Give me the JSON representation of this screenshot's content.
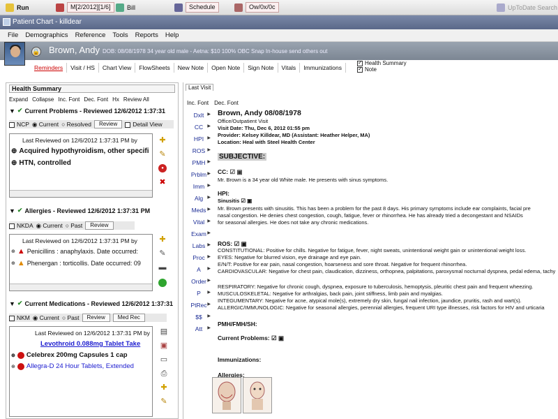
{
  "taskbar": {
    "run_label": "Run",
    "date_box": "M[2/2012][1/6]",
    "bill_label": "Bill",
    "schedule_label": "Schedule",
    "dx_box": "Ow/0x/0c",
    "right_label": "UpToDate Search"
  },
  "window_title": "Patient Chart - killdear",
  "menu": [
    "File",
    "Demographics",
    "Reference",
    "Tools",
    "Reports",
    "Help"
  ],
  "patient": {
    "name": "Brown, Andy",
    "info": "DOB: 08/08/1978  34 year old male - Aetna: $10 100% OBC  Snap In-house  send others out"
  },
  "nav_tabs": [
    "Reminders",
    "Visit / HS",
    "Chart View",
    "FlowSheets",
    "New Note",
    "Open Note",
    "Sign Note",
    "Vitals",
    "Immunizations"
  ],
  "checks": {
    "health_summary": "Health Summary",
    "note": "Note"
  },
  "left": {
    "title": "Health Summary",
    "toolbar": [
      "Expand",
      "Collapse",
      "Inc. Font",
      "Dec. Font",
      "Hx",
      "Review All"
    ],
    "problems": {
      "header": "Current Problems  - Reviewed 12/6/2012 1:37:31",
      "opts": [
        "NCP",
        "Current",
        "Resolved",
        "Review",
        "Detail View"
      ],
      "last_reviewed": "Last Reviewed on 12/6/2012 1:37:31 PM by",
      "items": [
        "Acquired hypothyroidism, other specifi",
        "HTN, controlled"
      ]
    },
    "allergies": {
      "header": "Allergies  - Reviewed 12/6/2012 1:37:31 PM",
      "opts": [
        "NKDA",
        "Current",
        "Past",
        "Review"
      ],
      "last_reviewed": "Last Reviewed on 12/6/2012 1:37:31 PM by",
      "items": [
        "Penicillins : anaphylaxis. Date occurred:",
        "Phenergan : torticollis. Date occurred: 09"
      ]
    },
    "meds": {
      "header": "Current Medications  - Reviewed 12/6/2012 1:37:31",
      "opts": [
        "NKM",
        "Current",
        "Past",
        "Review",
        "Med Rec"
      ],
      "last_reviewed": "Last Reviewed on 12/6/2012 1:37:31 PM by",
      "items": [
        "Levothroid 0.088mg Tablet Take",
        "Celebrex 200mg Capsules 1 cap",
        "Allegra-D 24 Hour Tablets, Extended"
      ]
    }
  },
  "right": {
    "tab": "Last Visit",
    "font_tools": [
      "Inc. Font",
      "Dec. Font"
    ],
    "side_nav": [
      "Dxlt",
      "CC",
      "HPI",
      "ROS",
      "PMH",
      "Prblm",
      "Imm",
      "Alg",
      "Meds",
      "Vital",
      "Exam",
      "Labs",
      "Proc",
      "A",
      "Order",
      "P",
      "PtRec",
      "$$",
      "Att"
    ],
    "note": {
      "header_name": "Brown, Andy  08/08/1978",
      "office": "Office/Outpatient Visit",
      "visit_date": "Visit Date: Thu, Dec 6, 2012 01:55 pm",
      "provider": "Provider: Kelsey Killdear, MD (Assistant: Heather Helper, MA)",
      "location": "Location: Heal with Steel Health Center",
      "subjective": "SUBJECTIVE:",
      "cc_label": "CC:",
      "cc_text": "Mr. Brown is a 34 year old White male.   He presents with sinus symptoms.",
      "hpi_label": "HPI:",
      "sinusitis_label": "Sinusitis",
      "hpi_1": "Mr. Brown presents with sinusitis.   This has been a problem for the past 8 days.   His primary symptoms include ear complaints, facial pre",
      "hpi_2": "nasal congestion.   He denies chest congestion, cough, fatigue, fever or rhinorrhea.   He has already tried a decongestant and NSAIDs",
      "hpi_3": "for seasonal allergies.   He does not take any chronic medications.",
      "ros_label": "ROS:",
      "ros_lines": [
        "CONSTITUTIONAL:  Positive for chills.   Negative for fatigue, fever, night sweats, unintentional weight gain or unintentional weight loss.",
        "EYES:  Negative for blurred vision, eye drainage and eye pain.",
        "E/N/T:  Positive for ear pain, nasal congestion, hoarseness and sore throat.   Negative for frequent rhinorrhea.",
        "CARDIOVASCULAR:  Negative for chest pain, claudication, dizziness, orthopnea, palpitations, paroxysmal nocturnal dyspnea, pedal edema, tachy",
        "RESPIRATORY:  Negative for chronic cough, dyspnea, exposure to tuberculosis, hemoptysis, pleuritic chest pain and frequent wheezing.",
        "MUSCULOSKELETAL:  Negative for arthralgias, back pain, joint stiffness, limb pain and myalgias.",
        "INTEGUMENTARY:  Negative for acne, atypical mole(s), extremely dry skin, fungal nail infection, jaundice, pruritis, rash and wart(s).",
        "ALLERGIC/IMMUNOLOGIC:  Negative for seasonal allergies, perennial allergies, frequent URI type illnesses, risk factors for HIV and urticaria"
      ],
      "pmh_label": "PMH/FMH/SH:",
      "current_problems_label": "Current Problems:",
      "immunizations_label": "Immunizations:",
      "allergies_label": "Allergies:"
    }
  },
  "colors": {
    "accent_red": "#cc0000",
    "nav_blue": "#1b2c95",
    "med_blue": "#1a1acf",
    "title_bar": "#5a6889"
  }
}
